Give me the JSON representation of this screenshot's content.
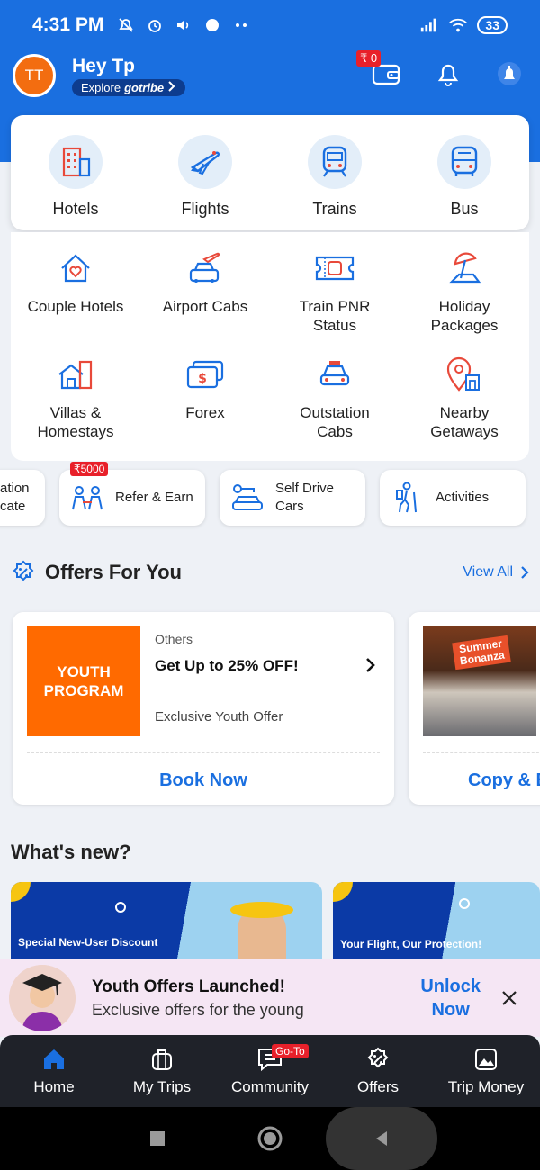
{
  "status_bar": {
    "time": "4:31 PM",
    "battery": "33"
  },
  "header": {
    "greeting": "Hey Tp",
    "avatar_initials": "TT",
    "explore_prefix": "Explore",
    "explore_brand": "gotribe",
    "wallet_amount": "₹ 0"
  },
  "main_services": [
    {
      "label": "Hotels",
      "icon": "hotel-icon"
    },
    {
      "label": "Flights",
      "icon": "flight-icon"
    },
    {
      "label": "Trains",
      "icon": "train-icon"
    },
    {
      "label": "Bus",
      "icon": "bus-icon"
    }
  ],
  "sub_services": [
    {
      "label": "Couple Hotels",
      "icon": "heart-home-icon"
    },
    {
      "label": "Airport Cabs",
      "icon": "airport-cab-icon"
    },
    {
      "label": "Train PNR\nStatus",
      "icon": "ticket-icon"
    },
    {
      "label": "Holiday\nPackages",
      "icon": "beach-umbrella-icon"
    },
    {
      "label": "Villas &\nHomestays",
      "icon": "villa-icon"
    },
    {
      "label": "Forex",
      "icon": "money-icon"
    },
    {
      "label": "Outstation\nCabs",
      "icon": "taxi-icon"
    },
    {
      "label": "Nearby\nGetaways",
      "icon": "location-pin-icon"
    }
  ],
  "pills": [
    {
      "label": "ation\ncate"
    },
    {
      "label": "Refer & Earn",
      "badge": "₹5000"
    },
    {
      "label": "Self Drive\nCars"
    },
    {
      "label": "Activities"
    }
  ],
  "offers": {
    "title": "Offers For You",
    "view_all": "View All",
    "cards": [
      {
        "thumb_text": "YOUTH\nPROGRAM",
        "category": "Others",
        "title": "Get Up to 25% OFF!",
        "subtitle": "Exclusive Youth Offer",
        "cta": "Book Now"
      },
      {
        "thumb_text": "Summer\nBonanza",
        "cta": "Copy & E"
      }
    ]
  },
  "whats_new": {
    "title": "What's new?",
    "banners": [
      {
        "text": "Special New-User Discount"
      },
      {
        "text": "Your Flight, Our Protection!"
      }
    ]
  },
  "promo": {
    "title": "Youth Offers Launched!",
    "subtitle": "Exclusive offers for the young",
    "cta": "Unlock\nNow"
  },
  "bottom_nav": [
    {
      "label": "Home",
      "icon": "home-icon",
      "active": true
    },
    {
      "label": "My Trips",
      "icon": "suitcase-icon"
    },
    {
      "label": "Community",
      "icon": "chat-icon",
      "badge": "Go-To"
    },
    {
      "label": "Offers",
      "icon": "percent-badge-icon"
    },
    {
      "label": "Trip Money",
      "icon": "image-icon"
    }
  ],
  "colors": {
    "brand_blue": "#1a6fe0",
    "badge_red": "#e8202a",
    "nav_dark": "#1f2229",
    "youth_orange": "#ff6a00"
  }
}
